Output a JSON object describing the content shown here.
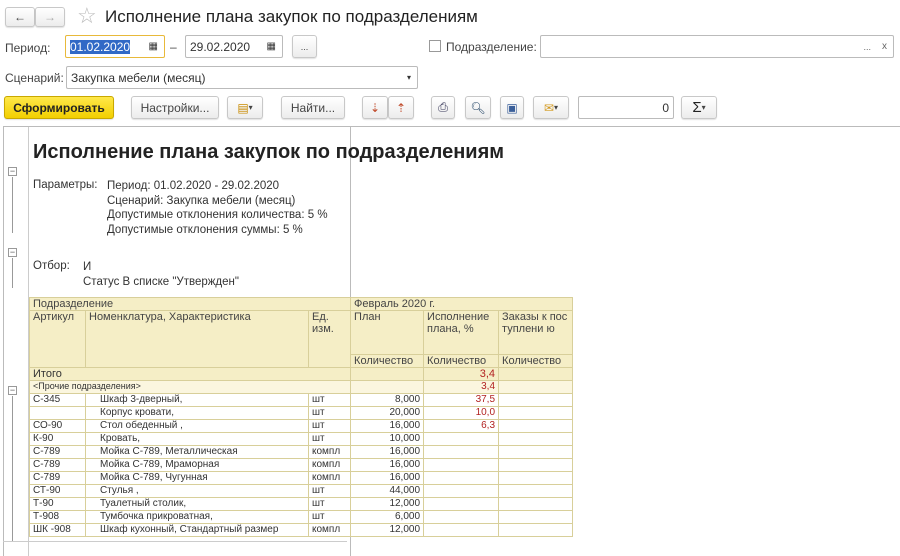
{
  "window": {
    "title": "Исполнение плана закупок по подразделениям"
  },
  "nav": {
    "back": "←",
    "forward": "→",
    "star": "☆"
  },
  "filters": {
    "period_label": "Период:",
    "date_from": "01.02.2020",
    "dash": "–",
    "date_to": "29.02.2020",
    "period_more": "...",
    "division_label": "Подразделение:",
    "division_value": "",
    "division_more": "...",
    "division_clear": "x",
    "scenario_label": "Сценарий:",
    "scenario_value": "Закупка мебели (месяц)"
  },
  "toolbar": {
    "generate": "Сформировать",
    "settings": "Настройки...",
    "find": "Найти...",
    "sum_value": "0",
    "sigma": "Σ"
  },
  "report": {
    "title": "Исполнение плана закупок по подразделениям",
    "params_label": "Параметры:",
    "params": [
      "Период: 01.02.2020 - 29.02.2020",
      "Сценарий: Закупка мебели (месяц)",
      "Допустимые отклонения количества: 5 %",
      "Допустимые отклонения суммы: 5 %"
    ],
    "filter_label": "Отбор:",
    "filter_lines": [
      "И",
      "Статус В списке \"Утвержден\""
    ],
    "headers": {
      "division": "Подразделение",
      "period": "Февраль 2020 г.",
      "article": "Артикул",
      "item": "Номенклатура, Характеристика",
      "unit": "Ед. изм.",
      "plan": "План",
      "execution": "Исполнение плана, %",
      "orders": "Заказы к поступлени ю",
      "qty1": "Количество",
      "qty2": "Количество",
      "qty3": "Количество"
    },
    "total": {
      "label": "Итого",
      "execution": "3,4"
    },
    "group": {
      "label": "<Прочие подразделения>",
      "execution": "3,4"
    },
    "rows": [
      {
        "article": "С-345",
        "item": "Шкаф 3-дверный,",
        "unit": "шт",
        "plan": "8,000",
        "execution": "37,5"
      },
      {
        "article": "",
        "item": "Корпус кровати,",
        "unit": "шт",
        "plan": "20,000",
        "execution": "10,0"
      },
      {
        "article": "СО-90",
        "item": "Стол обеденный ,",
        "unit": "шт",
        "plan": "16,000",
        "execution": "6,3"
      },
      {
        "article": "К-90",
        "item": "Кровать,",
        "unit": "шт",
        "plan": "10,000",
        "execution": ""
      },
      {
        "article": "С-789",
        "item": "Мойка С-789, Металлическая",
        "unit": "компл",
        "plan": "16,000",
        "execution": ""
      },
      {
        "article": "С-789",
        "item": "Мойка С-789, Мраморная",
        "unit": "компл",
        "plan": "16,000",
        "execution": ""
      },
      {
        "article": "С-789",
        "item": "Мойка С-789, Чугунная",
        "unit": "компл",
        "plan": "16,000",
        "execution": ""
      },
      {
        "article": "СТ-90",
        "item": "Стулья ,",
        "unit": "шт",
        "plan": "44,000",
        "execution": ""
      },
      {
        "article": "Т-90",
        "item": "Туалетный столик,",
        "unit": "шт",
        "plan": "12,000",
        "execution": ""
      },
      {
        "article": "Т-908",
        "item": "Тумбочка прикроватная,",
        "unit": "шт",
        "plan": "6,000",
        "execution": ""
      },
      {
        "article": "ШК -908",
        "item": "Шкаф кухонный, Стандартный размер",
        "unit": "компл",
        "plan": "12,000",
        "execution": ""
      }
    ]
  }
}
